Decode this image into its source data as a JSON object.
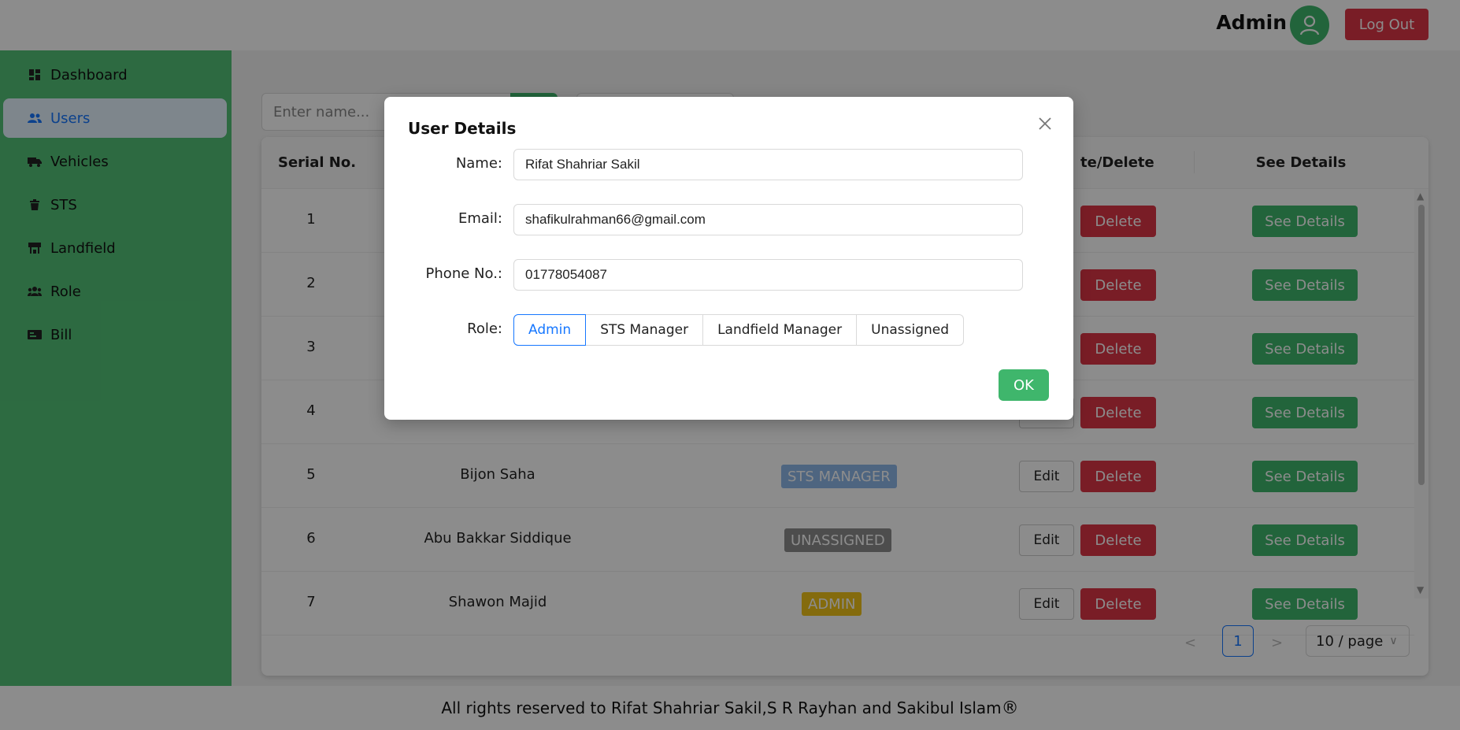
{
  "header": {
    "user_label": "Admin",
    "avatar_icon": "user-icon",
    "logout_label": "Log Out"
  },
  "sidebar": {
    "items": [
      {
        "label": "Dashboard",
        "icon": "dashboard-icon"
      },
      {
        "label": "Users",
        "icon": "users-icon",
        "active": true
      },
      {
        "label": "Vehicles",
        "icon": "truck-icon"
      },
      {
        "label": "STS",
        "icon": "trash-bin-icon"
      },
      {
        "label": "Landfield",
        "icon": "landfield-icon"
      },
      {
        "label": "Role",
        "icon": "team-icon"
      },
      {
        "label": "Bill",
        "icon": "bill-icon"
      }
    ]
  },
  "search": {
    "placeholder": "Enter name..."
  },
  "table": {
    "headers": {
      "serial": "Serial No.",
      "update_delete": "te/Delete",
      "see_details": "See Details"
    },
    "rows": [
      {
        "serial": "1",
        "name": "",
        "role": "",
        "edit": "",
        "delete": "Delete",
        "details": "See Details"
      },
      {
        "serial": "2",
        "name": "",
        "role": "",
        "edit": "",
        "delete": "Delete",
        "details": "See Details"
      },
      {
        "serial": "3",
        "name": "",
        "role": "",
        "edit": "",
        "delete": "Delete",
        "details": "See Details"
      },
      {
        "serial": "4",
        "name": "",
        "role": "",
        "edit": "",
        "delete": "Delete",
        "details": "See Details"
      },
      {
        "serial": "5",
        "name": "Bijon Saha",
        "role": "STS MANAGER",
        "edit": "Edit",
        "delete": "Delete",
        "details": "See Details"
      },
      {
        "serial": "6",
        "name": "Abu Bakkar Siddique",
        "role": "UNASSIGNED",
        "edit": "Edit",
        "delete": "Delete",
        "details": "See Details"
      },
      {
        "serial": "7",
        "name": "Shawon Majid",
        "role": "ADMIN",
        "edit": "Edit",
        "delete": "Delete",
        "details": "See Details"
      }
    ]
  },
  "pagination": {
    "current_page": "1",
    "page_size": "10 / page"
  },
  "footer": {
    "text": "All rights reserved to Rifat Shahriar Sakil,S R Rayhan and Sakibul Islam",
    "mark": "®"
  },
  "modal": {
    "title": "User Details",
    "name_label": "Name",
    "name_value": "Rifat Shahriar Sakil",
    "email_label": "Email",
    "email_value": "shafikulrahman66@gmail.com",
    "phone_label": "Phone No.",
    "phone_value": "01778054087",
    "role_label": "Role",
    "role_options": [
      "Admin",
      "STS Manager",
      "Landfield Manager",
      "Unassigned"
    ],
    "selected_role": "Admin",
    "ok_label": "OK"
  },
  "colors": {
    "sidebar": "#52c277",
    "accent_green": "#3fb66c",
    "danger": "#dc3545",
    "primary": "#1677ff",
    "badge_sts_manager": "#8fb8ea",
    "badge_unassigned": "#8c8c8c",
    "badge_admin": "#f0c419"
  }
}
